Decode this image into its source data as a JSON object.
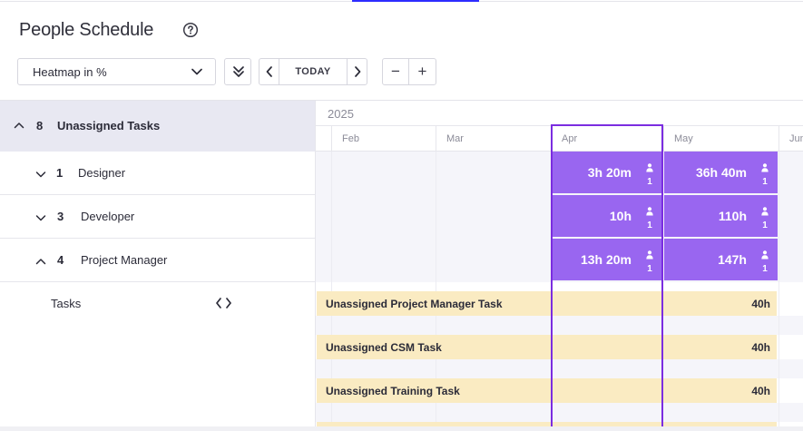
{
  "page": {
    "title": "People Schedule"
  },
  "toolbar": {
    "view_select": "Heatmap in %",
    "today_label": "TODAY",
    "zoom_out": "−",
    "zoom_in": "+"
  },
  "sidebar": {
    "group": {
      "count": "8",
      "label": "Unassigned Tasks"
    },
    "roles": [
      {
        "count": "1",
        "label": "Designer",
        "expanded": false
      },
      {
        "count": "3",
        "label": "Developer",
        "expanded": false
      },
      {
        "count": "4",
        "label": "Project Manager",
        "expanded": true
      }
    ],
    "tasks_label": "Tasks"
  },
  "timeline": {
    "year": "2025",
    "months": [
      "Feb",
      "Mar",
      "Apr",
      "May",
      "Jun"
    ],
    "current_month": "Apr"
  },
  "heatmap": [
    {
      "role": "Designer",
      "apr": "3h 20m",
      "may": "36h 40m",
      "apr_people": "1",
      "may_people": "1"
    },
    {
      "role": "Developer",
      "apr": "10h",
      "may": "110h",
      "apr_people": "1",
      "may_people": "1"
    },
    {
      "role": "Project Manager",
      "apr": "13h 20m",
      "may": "147h",
      "apr_people": "1",
      "may_people": "1"
    }
  ],
  "tasks": [
    {
      "name": "Unassigned Project Manager Task",
      "hours": "40h"
    },
    {
      "name": "Unassigned CSM Task",
      "hours": "40h"
    },
    {
      "name": "Unassigned Training Task",
      "hours": "40h"
    }
  ],
  "colors": {
    "heat_cell": "#9966f0",
    "today_outline": "#7b2de0",
    "task_bar": "#faebc2",
    "group_row": "#e8e8f2"
  }
}
